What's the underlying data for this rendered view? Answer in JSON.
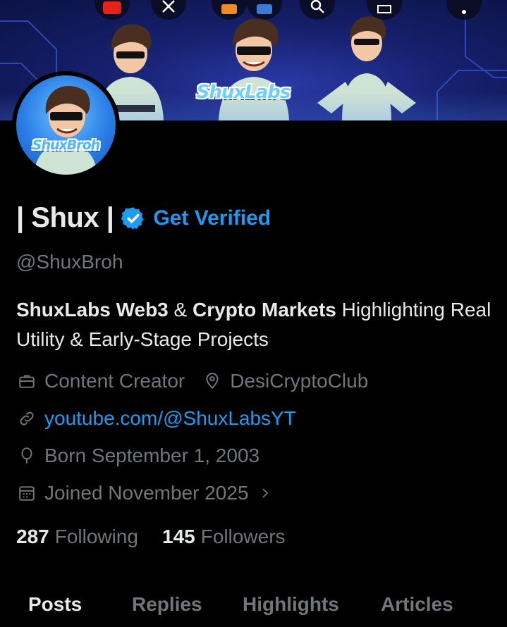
{
  "banner": {
    "logo_text": "ShuxLabs",
    "top_icons": [
      "youtube-icon",
      "x-logo-icon",
      "app-icon",
      "app-icon",
      "search-icon",
      "app-icon",
      "more-icon"
    ]
  },
  "avatar": {
    "logo_text": "ShuxBroh"
  },
  "profile": {
    "display_name": "| Shux |",
    "get_verified_label": "Get Verified",
    "handle": "@ShuxBroh",
    "bio": {
      "part1_bold": "ShuxLabs Web3",
      "part2": " & ",
      "part3_bold": "Crypto Markets",
      "part4": " Highlighting Real Utility & Early-Stage Projects"
    },
    "category": "Content Creator",
    "location": "DesiCryptoClub",
    "website": "youtube.com/@ShuxLabsYT",
    "birthday": "Born September 1, 2003",
    "joined": "Joined November 2025",
    "following_count": "287",
    "following_label": "Following",
    "followers_count": "145",
    "followers_label": "Followers"
  },
  "tabs": [
    "Posts",
    "Replies",
    "Highlights",
    "Articles"
  ],
  "active_tab": "Posts",
  "colors": {
    "background": "#000000",
    "text_primary": "#e7e9ea",
    "text_secondary": "#71767b",
    "accent": "#1d9bf0"
  }
}
